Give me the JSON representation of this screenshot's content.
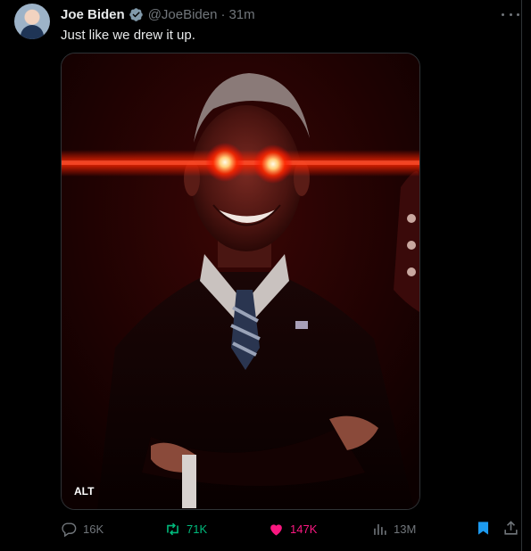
{
  "author": {
    "name": "Joe Biden",
    "handle": "@JoeBiden",
    "separator": "·",
    "time": "31m"
  },
  "tweet": {
    "text": "Just like we drew it up."
  },
  "media": {
    "alt_badge": "ALT"
  },
  "actions": {
    "replies": "16K",
    "reposts": "71K",
    "likes": "147K",
    "views": "13M"
  },
  "colors": {
    "background": "#000000",
    "text": "#e7e9ea",
    "muted": "#71767b",
    "repost_active": "#00ba7c",
    "like_active": "#f91880",
    "bookmark_active": "#1d9bf0",
    "laser_red": "#ff1a00"
  },
  "icons": {
    "verified": "verified-badge-icon",
    "more": "more-icon",
    "reply": "reply-icon",
    "repost": "repost-icon",
    "like": "heart-icon",
    "views": "views-icon",
    "bookmark": "bookmark-icon",
    "share": "share-icon"
  }
}
